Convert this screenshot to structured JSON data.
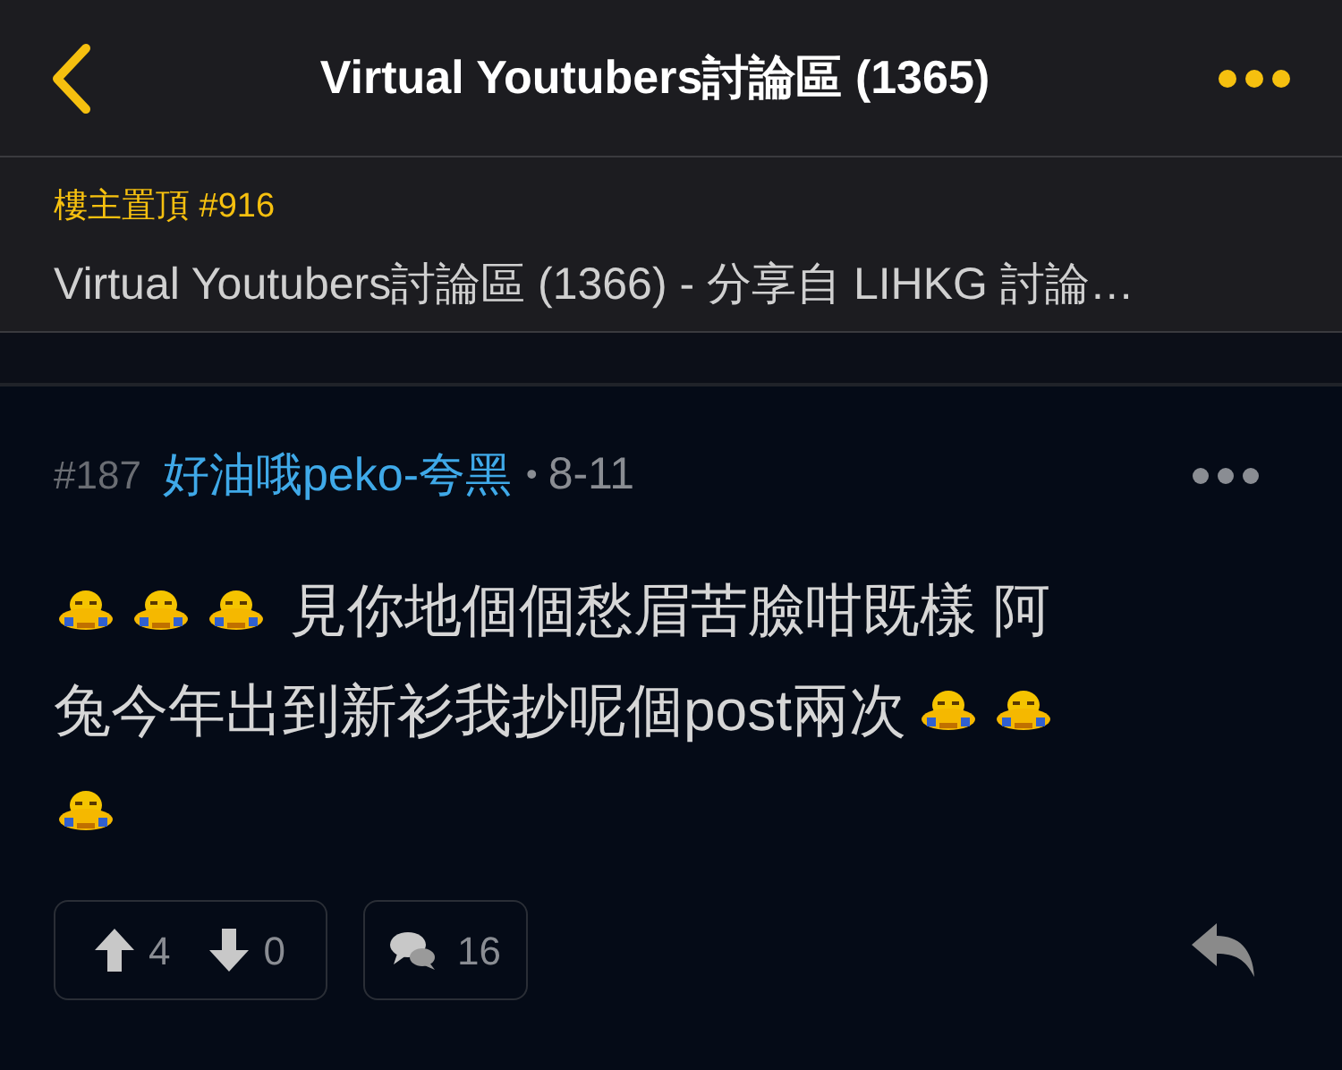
{
  "header": {
    "title": "Virtual Youtubers討論區 (1365)"
  },
  "pinned": {
    "label": "樓主置頂 #916",
    "text": "Virtual Youtubers討論區 (1366) - 分享自 LIHKG 討論…"
  },
  "post": {
    "number": "#187",
    "author": "好油哦peko-夸黑",
    "separator": "•",
    "date": "8-11",
    "body": [
      [
        {
          "kind": "emoji"
        },
        {
          "kind": "emoji"
        },
        {
          "kind": "emoji"
        },
        {
          "kind": "text",
          "text": "見你地個個愁眉苦臉咁既樣 阿"
        }
      ],
      [
        {
          "kind": "text",
          "text": "兔今年出到新衫我抄呢個post兩次"
        },
        {
          "kind": "emoji"
        },
        {
          "kind": "emoji"
        }
      ],
      [
        {
          "kind": "emoji"
        }
      ]
    ],
    "upvotes": "4",
    "downvotes": "0",
    "replies": "16"
  }
}
